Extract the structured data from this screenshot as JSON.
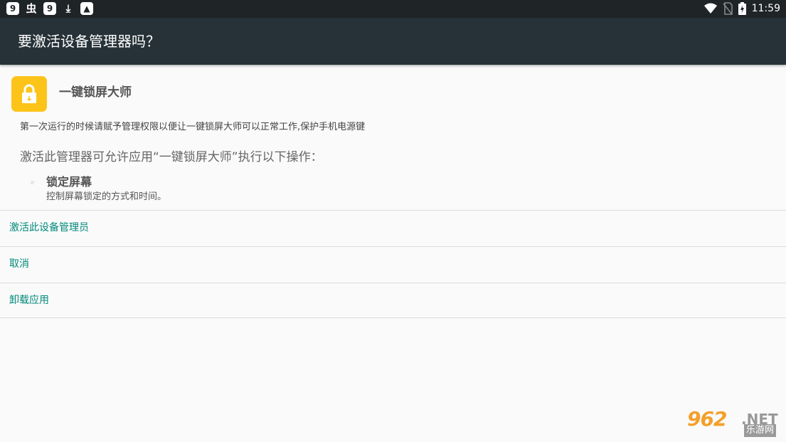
{
  "status_bar": {
    "left_icons": [
      "9-app-icon",
      "bug-icon",
      "9-app-icon",
      "download-icon",
      "photo-icon"
    ],
    "left_glyphs": [
      "9",
      "虫",
      "9",
      "⤓",
      "▲"
    ],
    "right_icons": [
      "wifi-icon",
      "no-sim-icon",
      "battery-charging-icon"
    ],
    "time": "11:59"
  },
  "dialog": {
    "title": "要激活设备管理器吗？",
    "app_name": "一键锁屏大师",
    "app_icon": "lock-icon",
    "app_icon_color": "#fcc419",
    "description": "第一次运行的时候请赋予管理权限以便让一键锁屏大师可以正常工作,保护手机电源键",
    "policy_heading": "激活此管理器可允许应用“一键锁屏大师”执行以下操作：",
    "policies": [
      {
        "name": "锁定屏幕",
        "description": "控制屏幕锁定的方式和时间。"
      }
    ]
  },
  "actions": {
    "activate": "激活此设备管理员",
    "cancel": "取消",
    "uninstall": "卸载应用"
  },
  "accent_color": "#00897b",
  "watermark": {
    "brand": "962",
    "suffix": ".NET",
    "sub": "乐游网"
  }
}
